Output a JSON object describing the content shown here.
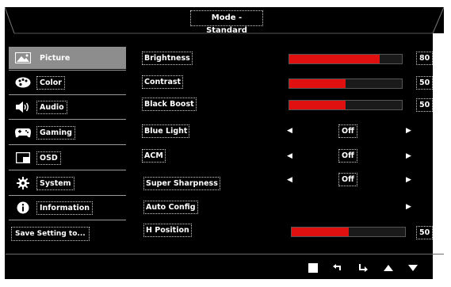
{
  "header": {
    "title": "Mode - Standard"
  },
  "sidebar": {
    "items": [
      {
        "label": "Picture",
        "icon": "picture-icon",
        "active": true
      },
      {
        "label": "Color",
        "icon": "palette-icon"
      },
      {
        "label": "Audio",
        "icon": "speaker-icon"
      },
      {
        "label": "Gaming",
        "icon": "gamepad-icon"
      },
      {
        "label": "OSD",
        "icon": "osd-window-icon"
      },
      {
        "label": "System",
        "icon": "gear-icon"
      },
      {
        "label": "Information",
        "icon": "info-icon"
      }
    ],
    "save_label": "Save Setting to..."
  },
  "settings": {
    "brightness": {
      "label": "Brightness",
      "value": "80",
      "level": 0.8
    },
    "contrast": {
      "label": "Contrast",
      "value": "50",
      "level": 0.5
    },
    "black_boost": {
      "label": "Black Boost",
      "value": "50",
      "level": 0.5
    },
    "blue_light": {
      "label": "Blue Light",
      "value": "Off"
    },
    "acm": {
      "label": "ACM",
      "value": "Off"
    },
    "super_sharpness": {
      "label": "Super Sharpness",
      "value": "Off"
    },
    "auto_config": {
      "label": "Auto Config"
    },
    "h_position": {
      "label": "H Position",
      "value": "50",
      "level": 0.5
    }
  },
  "colors": {
    "accent": "#e01010",
    "active_menu": "#8d8d8d",
    "background": "#000000"
  },
  "nav": [
    "stop-square-icon",
    "back-return-icon",
    "enter-arrow-icon",
    "up-arrow-icon",
    "down-arrow-icon"
  ]
}
